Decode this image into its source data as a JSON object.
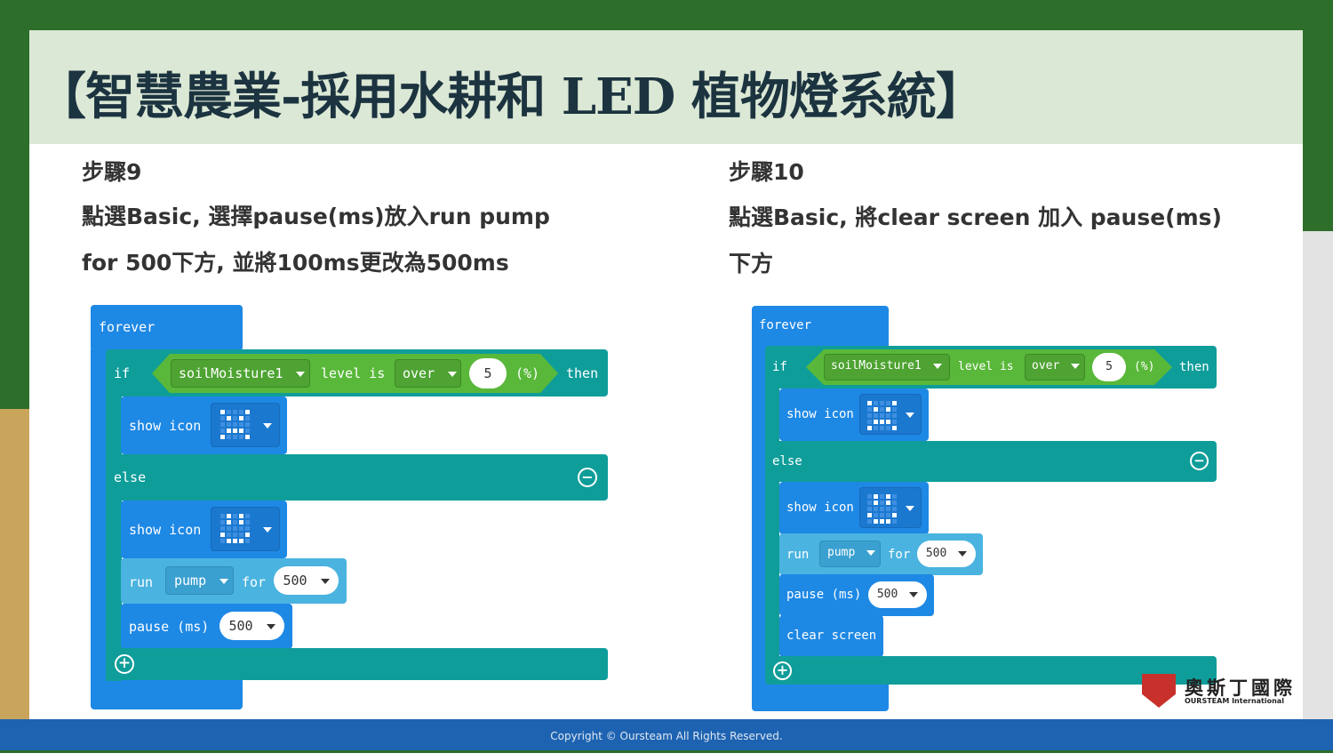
{
  "slide": {
    "title": "【智慧農業-採用水耕和 LED 植物燈系統】",
    "footer": "Copyright © Oursteam All Rights Reserved."
  },
  "step9": {
    "title": "步驟9",
    "line1": "點選Basic, 選擇pause(ms)放入run pump",
    "line2": "for 500下方, 並將100ms更改為500ms"
  },
  "step10": {
    "title": "步驟10",
    "line1": "點選Basic, 將clear screen 加入 pause(ms)",
    "line2": "下方"
  },
  "blocks": {
    "forever": "forever",
    "if": "if",
    "sensor": "soilMoisture1",
    "level_is": "level is",
    "comparison": "over",
    "threshold": "5",
    "percent": "(%)",
    "then": "then",
    "show_icon": "show icon",
    "else": "else",
    "run": "run",
    "pump": "pump",
    "for": "for",
    "run_duration": "500",
    "pause": "pause (ms)",
    "pause_value": "500",
    "clear_screen": "clear screen"
  },
  "logo": {
    "name": "奧斯丁國際",
    "sub": "OURSTEAM International"
  },
  "colors": {
    "forever": "#1e88e5",
    "logic": "#0f9d9a",
    "sensor": "#59b83a",
    "pump": "#4ab3e0",
    "title_bar": "#dbe8d5",
    "footer": "#1e63b1"
  }
}
